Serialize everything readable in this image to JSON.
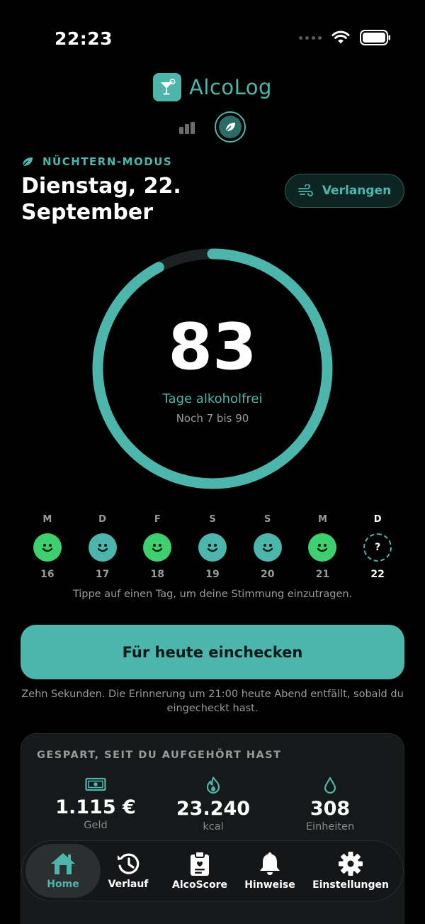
{
  "status_bar": {
    "time": "22:23"
  },
  "app": {
    "name": "AlcoLog"
  },
  "header": {
    "mode_label": "NÜCHTERN-MODUS",
    "date": "Dienstag, 22. September",
    "craving_button": "Verlangen"
  },
  "progress": {
    "days": "83",
    "label": "Tage alkoholfrei",
    "remaining": "Noch 7 bis 90",
    "current": 83,
    "goal": 90
  },
  "week": [
    {
      "letter": "M",
      "day": "16",
      "mood": "happy",
      "color": "#3ecf6e"
    },
    {
      "letter": "D",
      "day": "17",
      "mood": "happy",
      "color": "#4db6ac"
    },
    {
      "letter": "F",
      "day": "18",
      "mood": "happy",
      "color": "#3ecf6e"
    },
    {
      "letter": "S",
      "day": "19",
      "mood": "happy",
      "color": "#4db6ac"
    },
    {
      "letter": "S",
      "day": "20",
      "mood": "happy",
      "color": "#4db6ac"
    },
    {
      "letter": "M",
      "day": "21",
      "mood": "happy",
      "color": "#3ecf6e"
    },
    {
      "letter": "D",
      "day": "22",
      "mood": "unknown",
      "symbol": "?"
    }
  ],
  "mood_hint": "Tippe auf einen Tag, um deine Stimmung einzutragen.",
  "checkin": {
    "button": "Für heute einchecken",
    "note": "Zehn Sekunden. Die Erinnerung um 21:00 heute Abend entfällt, sobald du eingecheckt hast."
  },
  "savings": {
    "title": "GESPART, SEIT DU AUFGEHÖRT HAST",
    "stats": [
      {
        "icon": "money-icon",
        "value": "1.115 €",
        "label": "Geld"
      },
      {
        "icon": "flame-icon",
        "value": "23.240",
        "label": "kcal"
      },
      {
        "icon": "drop-icon",
        "value": "308",
        "label": "Einheiten"
      }
    ]
  },
  "tabs": [
    {
      "icon": "home-icon",
      "label": "Home",
      "active": true
    },
    {
      "icon": "history-icon",
      "label": "Verlauf"
    },
    {
      "icon": "clipboard-icon",
      "label": "AlcoScore"
    },
    {
      "icon": "bell-icon",
      "label": "Hinweise"
    },
    {
      "icon": "gear-icon",
      "label": "Einstellungen"
    }
  ],
  "colors": {
    "accent": "#4db6ac",
    "happy_green": "#3ecf6e",
    "background": "#000000",
    "card": "#16191a"
  }
}
